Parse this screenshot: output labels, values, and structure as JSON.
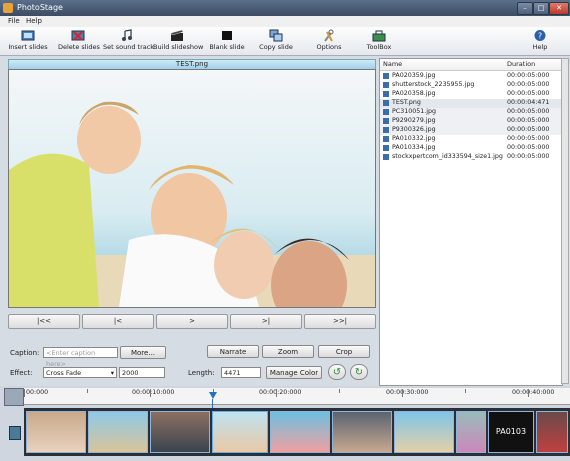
{
  "window": {
    "title": "PhotoStage"
  },
  "menu": [
    "File",
    "Help"
  ],
  "toolbar": {
    "insert_slides": "Insert slides",
    "delete_slides": "Delete slides",
    "set_sound_track": "Set sound track",
    "build_slideshow": "Build slideshow",
    "blank_slide": "Blank slide",
    "copy_slide": "Copy slide",
    "options": "Options",
    "toolbox": "ToolBox",
    "help": "Help"
  },
  "preview": {
    "filename": "TEST.png"
  },
  "nav": {
    "first": "|<<",
    "prev": "|<",
    "play": ">",
    "next": ">|",
    "last": ">>|"
  },
  "controls": {
    "caption_label": "Caption:",
    "caption_placeholder": "<Enter caption here>",
    "more_button": "More...",
    "narrate": "Narrate",
    "zoom": "Zoom",
    "crop": "Crop",
    "effect_label": "Effect:",
    "effect_value": "Cross Fade",
    "effect_duration": "2000",
    "length_label": "Length:",
    "length_value": "4471",
    "manage_color": "Manage Color"
  },
  "filelist": {
    "headers": {
      "name": "Name",
      "duration": "Duration"
    },
    "rows": [
      {
        "name": "PA020359.jpg",
        "duration": "00:00:05:000"
      },
      {
        "name": "shutterstock_2235955.jpg",
        "duration": "00:00:05:000"
      },
      {
        "name": "PA020358.jpg",
        "duration": "00:00:05:000"
      },
      {
        "name": "TEST.png",
        "duration": "00:00:04:471"
      },
      {
        "name": "PC310051.jpg",
        "duration": "00:00:05:000"
      },
      {
        "name": "P9290279.jpg",
        "duration": "00:00:05:000"
      },
      {
        "name": "P9300326.jpg",
        "duration": "00:00:05:000"
      },
      {
        "name": "PA010332.jpg",
        "duration": "00:00:05:000"
      },
      {
        "name": "PA010334.jpg",
        "duration": "00:00:05:000"
      },
      {
        "name": "stockxpertcom_id333594_size1.jpg",
        "duration": "00:00:05:000"
      }
    ]
  },
  "timeline": {
    "ruler_labels": [
      "00:000",
      "00:00:10:000",
      "00:00:20:000",
      "00:00:30:000",
      "00:00:40:000"
    ],
    "thumb_text": "PA0103"
  },
  "colors": {
    "accent": "#9fd0ea",
    "selected_row": "#e4e8ee"
  }
}
